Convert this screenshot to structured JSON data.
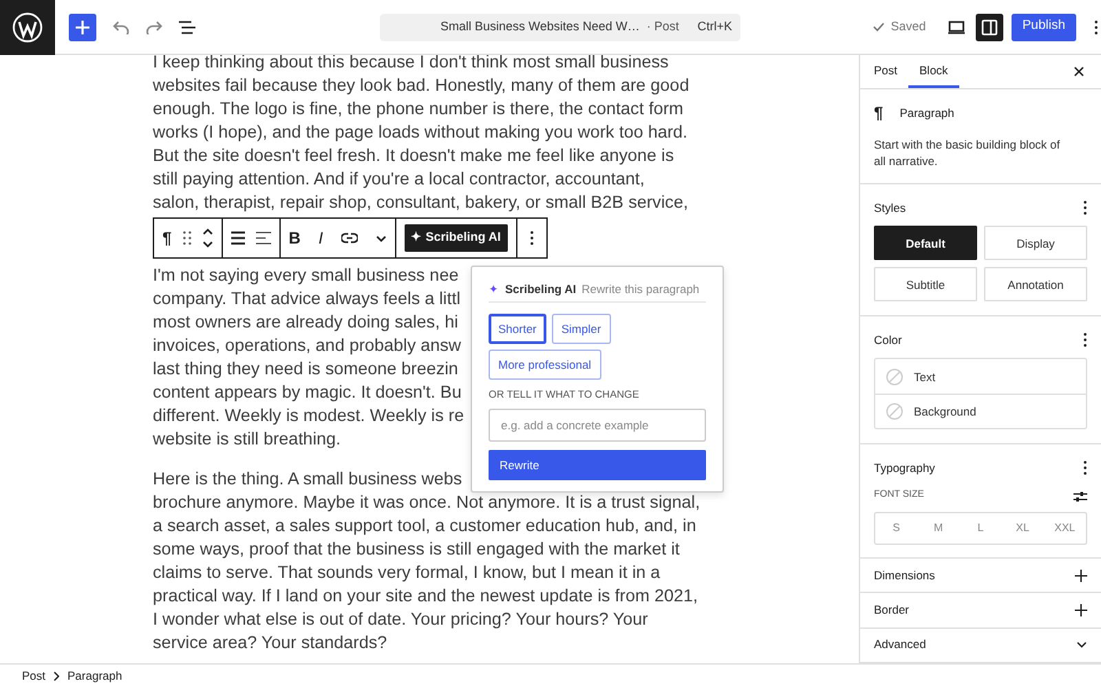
{
  "topbar": {
    "title": "Small Business Websites Need W…",
    "title_type": "· Post",
    "shortcut": "Ctrl+K",
    "save_status": "Saved",
    "settings_open": true,
    "publish": "Publish"
  },
  "block_toolbar": {
    "block_icon": "¶",
    "bold": "B",
    "italic": "I",
    "ai_glyph": "✦",
    "ai_button": "Scribeling AI"
  },
  "content": {
    "paragraphs": [
      {
        "lines": [
          "I keep thinking about this because I don't think most small business",
          "websites fail because they look bad. Honestly, many of them are good",
          "enough. The logo is fine, the phone number is there, the contact form",
          "works (I hope), and the page loads without making you work too hard.",
          "But the site doesn't feel fresh. It doesn't make me feel like anyone is",
          "still paying attention. And if you're a local contractor, accountant,",
          "salon, therapist, repair shop, consultant, bakery, or small B2B service,"
        ]
      },
      {
        "lines": [
          "I'm not saying every small business nee",
          "company. That advice always feels a littl",
          "most owners are already doing sales, hi",
          "invoices, operations, and probably answ",
          "last thing they need is someone breezin",
          "content appears by magic. It doesn't. Bu",
          "different. Weekly is modest. Weekly is re",
          "website is still breathing."
        ]
      },
      {
        "lines": [
          "Here is the thing. A small business webs",
          "brochure anymore. Maybe it was once. Not anymore. It is a trust signal,",
          "a search asset, a sales support tool, a customer education hub, and, in",
          "some ways, proof that the business is still engaged with the market it",
          "claims to serve. That sounds very formal, I know, but I mean it in a",
          "practical way. If I land on your site and the newest update is from 2021,",
          "I wonder what else is out of date. Your pricing? Your hours? Your",
          "service area? Your standards?"
        ]
      }
    ]
  },
  "ai_popover": {
    "glyph": "✦",
    "title": "Scribeling AI",
    "subtitle": "Rewrite this paragraph",
    "presets": [
      {
        "label": "Shorter",
        "selected": true
      },
      {
        "label": "Simpler",
        "selected": false
      },
      {
        "label": "More professional",
        "selected": false
      }
    ],
    "prompt_label": "OR TELL IT WHAT TO CHANGE",
    "prompt": {
      "placeholder": "e.g. add a concrete example"
    },
    "submit": "Rewrite"
  },
  "sidebar": {
    "tabs": [
      {
        "label": "Post",
        "selected": false
      },
      {
        "label": "Block",
        "selected": true
      }
    ],
    "block": {
      "icon": "¶",
      "name": "Paragraph",
      "description": "Start with the basic building block of all narrative."
    },
    "styles": {
      "title": "Styles",
      "options": [
        {
          "label": "Default",
          "selected": true
        },
        {
          "label": "Display",
          "selected": false
        },
        {
          "label": "Subtitle",
          "selected": false
        },
        {
          "label": "Annotation",
          "selected": false
        }
      ]
    },
    "color": {
      "title": "Color",
      "items": [
        "Text",
        "Background"
      ]
    },
    "typography": {
      "title": "Typography",
      "font_size_label": "FONT SIZE",
      "sizes": [
        {
          "label": "S",
          "selected": false
        },
        {
          "label": "M",
          "selected": false
        },
        {
          "label": "L",
          "selected": false
        },
        {
          "label": "XL",
          "selected": false
        },
        {
          "label": "XXL",
          "selected": false
        }
      ]
    },
    "panels": [
      {
        "title": "Dimensions",
        "kind": "plus"
      },
      {
        "title": "Border",
        "kind": "plus"
      },
      {
        "title": "Advanced",
        "kind": "chevron"
      }
    ]
  },
  "breadcrumb": [
    "Post",
    "Paragraph"
  ]
}
